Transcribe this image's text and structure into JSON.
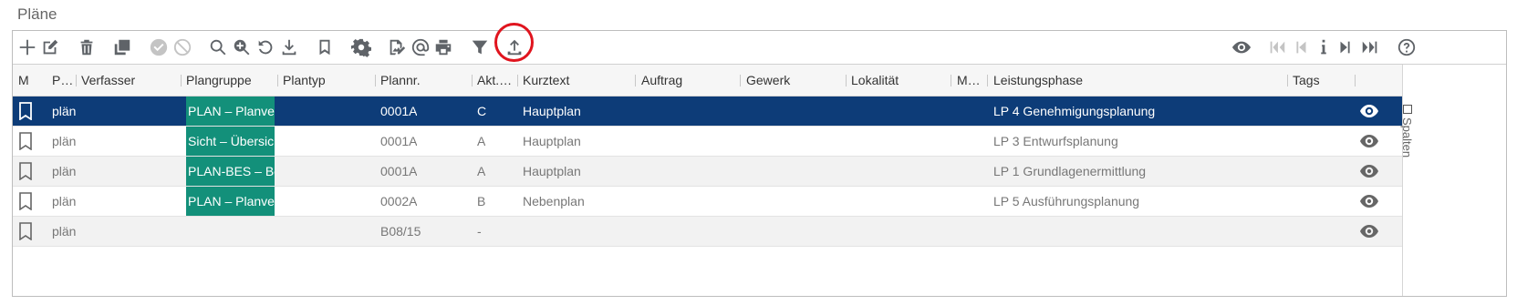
{
  "page": {
    "title": "Pläne"
  },
  "toolbar": {
    "left": [
      {
        "name": "add-icon",
        "x": true
      },
      {
        "name": "edit-icon"
      },
      {
        "name": "delete-icon"
      },
      {
        "name": "duplicate-icon"
      },
      {
        "name": "approve-icon",
        "disabled": true
      },
      {
        "name": "reject-icon",
        "disabled": true
      },
      {
        "name": "search-icon"
      },
      {
        "name": "zoom-in-icon"
      },
      {
        "name": "undo-icon"
      },
      {
        "name": "download-icon"
      },
      {
        "name": "bookmark-icon"
      },
      {
        "name": "gear-icon"
      },
      {
        "name": "sign-icon"
      },
      {
        "name": "at-icon"
      },
      {
        "name": "print-icon"
      },
      {
        "name": "filter-icon"
      },
      {
        "name": "upload-icon",
        "highlighted": true
      }
    ],
    "right": [
      {
        "name": "eye-icon"
      },
      {
        "name": "first-icon",
        "disabled": true
      },
      {
        "name": "previous-icon",
        "disabled": true
      },
      {
        "name": "info-icon"
      },
      {
        "name": "next-icon"
      },
      {
        "name": "last-icon"
      },
      {
        "name": "help-icon"
      }
    ]
  },
  "columns": [
    "M",
    "Pr…",
    "Verfasser",
    "Plangruppe",
    "Plantyp",
    "Plannr.",
    "Akt. I…",
    "Kurztext",
    "Auftrag",
    "Gewerk",
    "Lokalität",
    "Ma…",
    "Leistungsphase",
    "Tags"
  ],
  "rows": [
    {
      "pr": "plän",
      "plangruppe": "PLAN – Planverw",
      "plannr": "0001A",
      "akt": "C",
      "kurztext": "Hauptplan",
      "leistungsphase": "LP 4 Genehmigungsplanung",
      "selected": true
    },
    {
      "pr": "plän",
      "plangruppe": "Sicht – Übersich",
      "plannr": "0001A",
      "akt": "A",
      "kurztext": "Hauptplan",
      "leistungsphase": "LP 3 Entwurfsplanung"
    },
    {
      "pr": "plän",
      "plangruppe": "PLAN-BES – Bes",
      "plannr": "0001A",
      "akt": "A",
      "kurztext": "Hauptplan",
      "leistungsphase": "LP 1 Grundlagenermittlung"
    },
    {
      "pr": "plän",
      "plangruppe": "PLAN – Planverw",
      "plannr": "0002A",
      "akt": "B",
      "kurztext": "Nebenplan",
      "leistungsphase": "LP 5 Ausführungsplanung"
    },
    {
      "pr": "plän",
      "plangruppe": "",
      "plannr": "B08/15",
      "akt": "-",
      "kurztext": "",
      "leistungsphase": ""
    }
  ],
  "side_panel": {
    "label": "Spalten"
  },
  "colors": {
    "selected_row": "#0d3c78",
    "plangruppe_badge": "#13907a",
    "highlight": "#e0141e"
  }
}
